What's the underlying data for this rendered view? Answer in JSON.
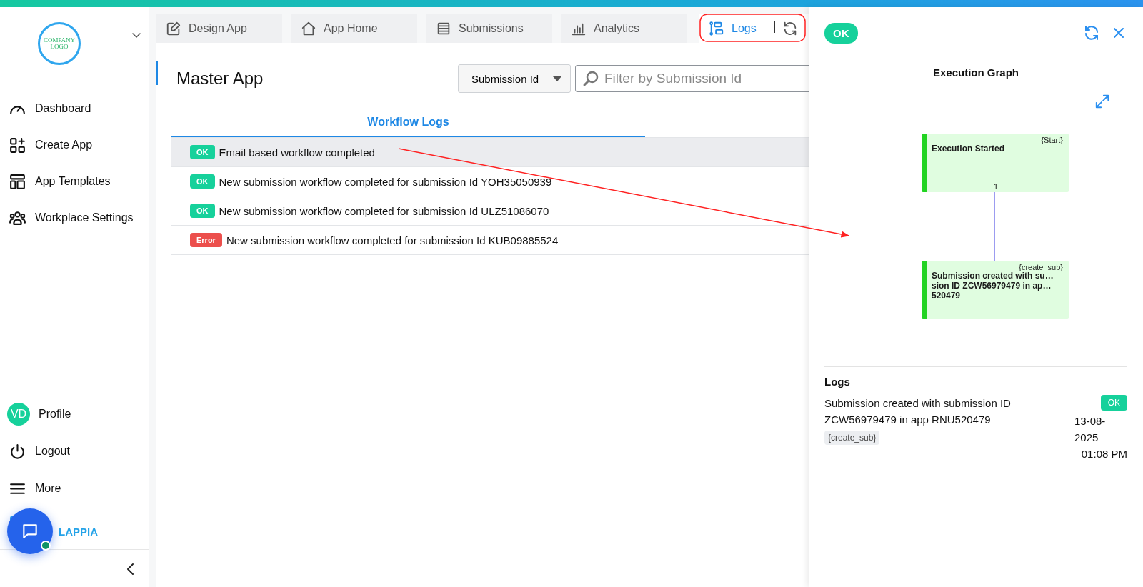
{
  "sidebar": {
    "logo": {
      "line_1": "COMPANY",
      "line_2": "LOGO"
    },
    "nav_items": [
      {
        "label": "Dashboard"
      },
      {
        "label": "Create App"
      },
      {
        "label": "App Templates"
      },
      {
        "label": "Workplace Settings"
      }
    ],
    "profile": {
      "initials": "VD",
      "label": "Profile"
    },
    "bottom_items": [
      {
        "label": "Logout"
      },
      {
        "label": "More"
      }
    ],
    "brand": "LAPPIA"
  },
  "tabs": [
    {
      "label": "Design App",
      "selected": false
    },
    {
      "label": "App Home",
      "selected": false
    },
    {
      "label": "Submissions",
      "selected": false
    },
    {
      "label": "Analytics",
      "selected": false
    },
    {
      "label": "Logs",
      "selected": true
    }
  ],
  "page_title": "Master App",
  "filter": {
    "field": "Submission Id",
    "placeholder": "Filter by Submission Id"
  },
  "log_tabs": [
    {
      "label": "Workflow Logs",
      "selected": true
    }
  ],
  "log_rows": [
    {
      "status": "OK",
      "kind": "ok",
      "message": "Email based workflow completed",
      "selected": true
    },
    {
      "status": "OK",
      "kind": "ok",
      "message": "New submission workflow completed for submission Id YOH35050939",
      "selected": false
    },
    {
      "status": "OK",
      "kind": "ok",
      "message": "New submission workflow completed for submission Id ULZ51086070",
      "selected": false
    },
    {
      "status": "Error",
      "kind": "error",
      "message": "New submission workflow completed for submission Id KUB09885524",
      "selected": false
    }
  ],
  "detail_panel": {
    "status": "OK",
    "kind": "ok",
    "graph_title": "Execution Graph",
    "nodes": [
      {
        "tag": "{Start}",
        "lines": [
          "Execution Started"
        ],
        "port": "1"
      },
      {
        "tag": "{create_sub}",
        "lines": [
          "Submission created with su…",
          "sion ID ZCW56979479 in ap…",
          "520479"
        ]
      }
    ],
    "logs_title": "Logs",
    "logs": [
      {
        "message": "Submission created with submission ID ZCW56979479 in app RNU520479",
        "tag": "{create_sub}",
        "status": "OK",
        "kind": "ok",
        "date": "13-08-2025",
        "time": "01:08 PM"
      }
    ]
  }
}
